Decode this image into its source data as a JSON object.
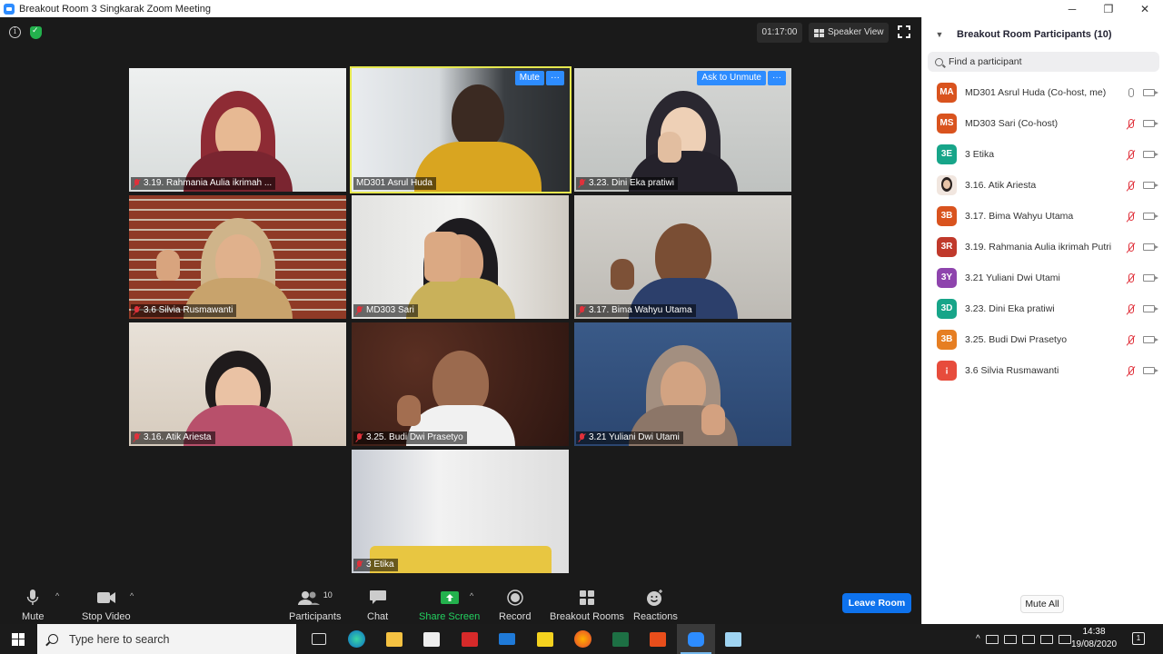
{
  "window": {
    "title": "Breakout Room 3 Singkarak   Zoom Meeting",
    "minimize": "─",
    "restore": "❐",
    "close": "✕"
  },
  "meeting": {
    "timer": "01:17:00",
    "view_label": "Speaker View"
  },
  "tiles": [
    {
      "name": "3.19. Rahmania Aulia ikrimah ...",
      "muted": true
    },
    {
      "name": "MD301 Asrul Huda",
      "muted": false,
      "active": true,
      "buttons": [
        "Mute",
        "···"
      ]
    },
    {
      "name": "3.23. Dini Eka pratiwi",
      "muted": true,
      "buttons": [
        "Ask to Unmute",
        "···"
      ]
    },
    {
      "name": "3.6 Silvia Rusmawanti",
      "muted": true
    },
    {
      "name": "MD303 Sari",
      "muted": true
    },
    {
      "name": "3.17. Bima Wahyu Utama",
      "muted": true
    },
    {
      "name": "3.16. Atik Ariesta",
      "muted": true
    },
    {
      "name": "3.25. Budi Dwi Prasetyo",
      "muted": true
    },
    {
      "name": "3.21 Yuliani Dwi Utami",
      "muted": true
    },
    {
      "name": "3 Etika",
      "muted": true
    }
  ],
  "toolbar": {
    "mute": "Mute",
    "stop_video": "Stop Video",
    "participants": "Participants",
    "participants_count": "10",
    "chat": "Chat",
    "share_screen": "Share Screen",
    "record": "Record",
    "breakout_rooms": "Breakout Rooms",
    "reactions": "Reactions",
    "leave": "Leave Room",
    "caret": "^"
  },
  "panel": {
    "title": "Breakout Room Participants (10)",
    "search_placeholder": "Find a participant",
    "mute_all": "Mute All",
    "participants": [
      {
        "initials": "MA",
        "color": "#d9531e",
        "name": "MD301 Asrul Huda (Co-host, me)",
        "mic_off": false
      },
      {
        "initials": "MS",
        "color": "#d9531e",
        "name": "MD303 Sari (Co-host)",
        "mic_off": true
      },
      {
        "initials": "3E",
        "color": "#17a589",
        "name": "3 Etika",
        "mic_off": true
      },
      {
        "initials": "",
        "color": "photo",
        "name": "3.16. Atik Ariesta",
        "mic_off": true
      },
      {
        "initials": "3B",
        "color": "#d9531e",
        "name": "3.17. Bima Wahyu Utama",
        "mic_off": true
      },
      {
        "initials": "3R",
        "color": "#c0392b",
        "name": "3.19. Rahmania Aulia ikrimah Putri",
        "mic_off": true
      },
      {
        "initials": "3Y",
        "color": "#8e44ad",
        "name": "3.21 Yuliani Dwi Utami",
        "mic_off": true
      },
      {
        "initials": "3D",
        "color": "#17a589",
        "name": "3.23. Dini Eka pratiwi",
        "mic_off": true
      },
      {
        "initials": "3B",
        "color": "#e67e22",
        "name": "3.25. Budi Dwi Prasetyo",
        "mic_off": true
      },
      {
        "initials": "¡",
        "color": "#e74c3c",
        "name": "3.6 Silvia Rusmawanti",
        "mic_off": true
      }
    ]
  },
  "taskbar": {
    "search_placeholder": "Type here to search",
    "time": "14:38",
    "date": "19/08/2020",
    "notification_count": "1",
    "tray_expand": "^"
  }
}
